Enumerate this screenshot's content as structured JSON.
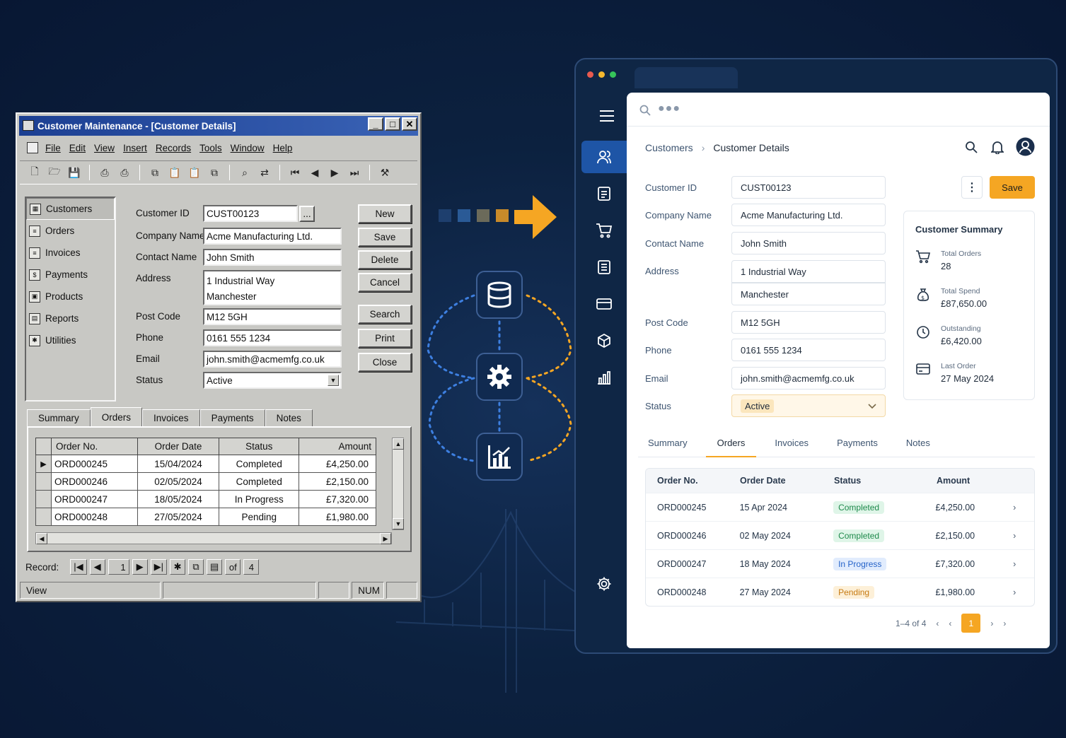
{
  "legacy": {
    "title": "Customer Maintenance - [Customer Details]",
    "menu": [
      "File",
      "Edit",
      "View",
      "Insert",
      "Records",
      "Tools",
      "Window",
      "Help"
    ],
    "nav": [
      "Customers",
      "Orders",
      "Invoices",
      "Payments",
      "Products",
      "Reports",
      "Utilities"
    ],
    "labels": {
      "customer_id": "Customer ID",
      "company_name": "Company Name",
      "contact_name": "Contact Name",
      "address": "Address",
      "post_code": "Post Code",
      "phone": "Phone",
      "email": "Email",
      "status": "Status"
    },
    "values": {
      "customer_id": "CUST00123",
      "company_name": "Acme Manufacturing Ltd.",
      "contact_name": "John Smith",
      "address1": "1 Industrial Way",
      "address2": "Manchester",
      "post_code": "M12 5GH",
      "phone": "0161 555 1234",
      "email": "john.smith@acmemfg.co.uk",
      "status": "Active"
    },
    "lookup_btn": "...",
    "buttons": [
      "New",
      "Save",
      "Delete",
      "Cancel",
      "Search",
      "Print",
      "Close"
    ],
    "tabs": [
      "Summary",
      "Orders",
      "Invoices",
      "Payments",
      "Notes"
    ],
    "grid_headers": [
      "Order No.",
      "Order Date",
      "Status",
      "Amount"
    ],
    "grid_rows": [
      [
        "ORD000245",
        "15/04/2024",
        "Completed",
        "£4,250.00"
      ],
      [
        "ORD000246",
        "02/05/2024",
        "Completed",
        "£2,150.00"
      ],
      [
        "ORD000247",
        "18/05/2024",
        "In Progress",
        "£7,320.00"
      ],
      [
        "ORD000248",
        "27/05/2024",
        "Pending",
        "£1,980.00"
      ]
    ],
    "record_label": "Record:",
    "record_current": "1",
    "record_of": "of",
    "record_total": "4",
    "status_bar": [
      "View",
      "NUM"
    ]
  },
  "modern": {
    "breadcrumb": [
      "Customers",
      "Customer Details"
    ],
    "labels": {
      "customer_id": "Customer ID",
      "company_name": "Company Name",
      "contact_name": "Contact Name",
      "address": "Address",
      "post_code": "Post Code",
      "phone": "Phone",
      "email": "Email",
      "status": "Status"
    },
    "values": {
      "customer_id": "CUST00123",
      "company_name": "Acme Manufacturing Ltd.",
      "contact_name": "John Smith",
      "address1": "1 Industrial Way",
      "address2": "Manchester",
      "post_code": "M12 5GH",
      "phone": "0161 555 1234",
      "email": "john.smith@acmemfg.co.uk",
      "status": "Active"
    },
    "save_label": "Save",
    "summary": {
      "title": "Customer Summary",
      "total_orders_label": "Total Orders",
      "total_orders": "28",
      "total_spend_label": "Total Spend",
      "total_spend": "£87,650.00",
      "outstanding_label": "Outstanding",
      "outstanding": "£6,420.00",
      "last_order_label": "Last Order",
      "last_order": "27 May 2024"
    },
    "tabs": [
      "Summary",
      "Orders",
      "Invoices",
      "Payments",
      "Notes"
    ],
    "table_headers": [
      "Order No.",
      "Order Date",
      "Status",
      "Amount"
    ],
    "table_rows": [
      {
        "order": "ORD000245",
        "date": "15 Apr 2024",
        "status": "Completed",
        "amount": "£4,250.00"
      },
      {
        "order": "ORD000246",
        "date": "02 May 2024",
        "status": "Completed",
        "amount": "£2,150.00"
      },
      {
        "order": "ORD000247",
        "date": "18 May 2024",
        "status": "In Progress",
        "amount": "£7,320.00"
      },
      {
        "order": "ORD000248",
        "date": "27 May 2024",
        "status": "Pending",
        "amount": "£1,980.00"
      }
    ],
    "pager_range": "1–4 of 4",
    "pager_page": "1"
  },
  "colors": {
    "accent": "#f5a623",
    "rail_active": "#1e55a6",
    "completed_bg": "#dff5e8",
    "completed_fg": "#1f8a4c",
    "progress_bg": "#e1ecfd",
    "progress_fg": "#2563c9",
    "pending_bg": "#fdf0d8",
    "pending_fg": "#c67a12"
  }
}
